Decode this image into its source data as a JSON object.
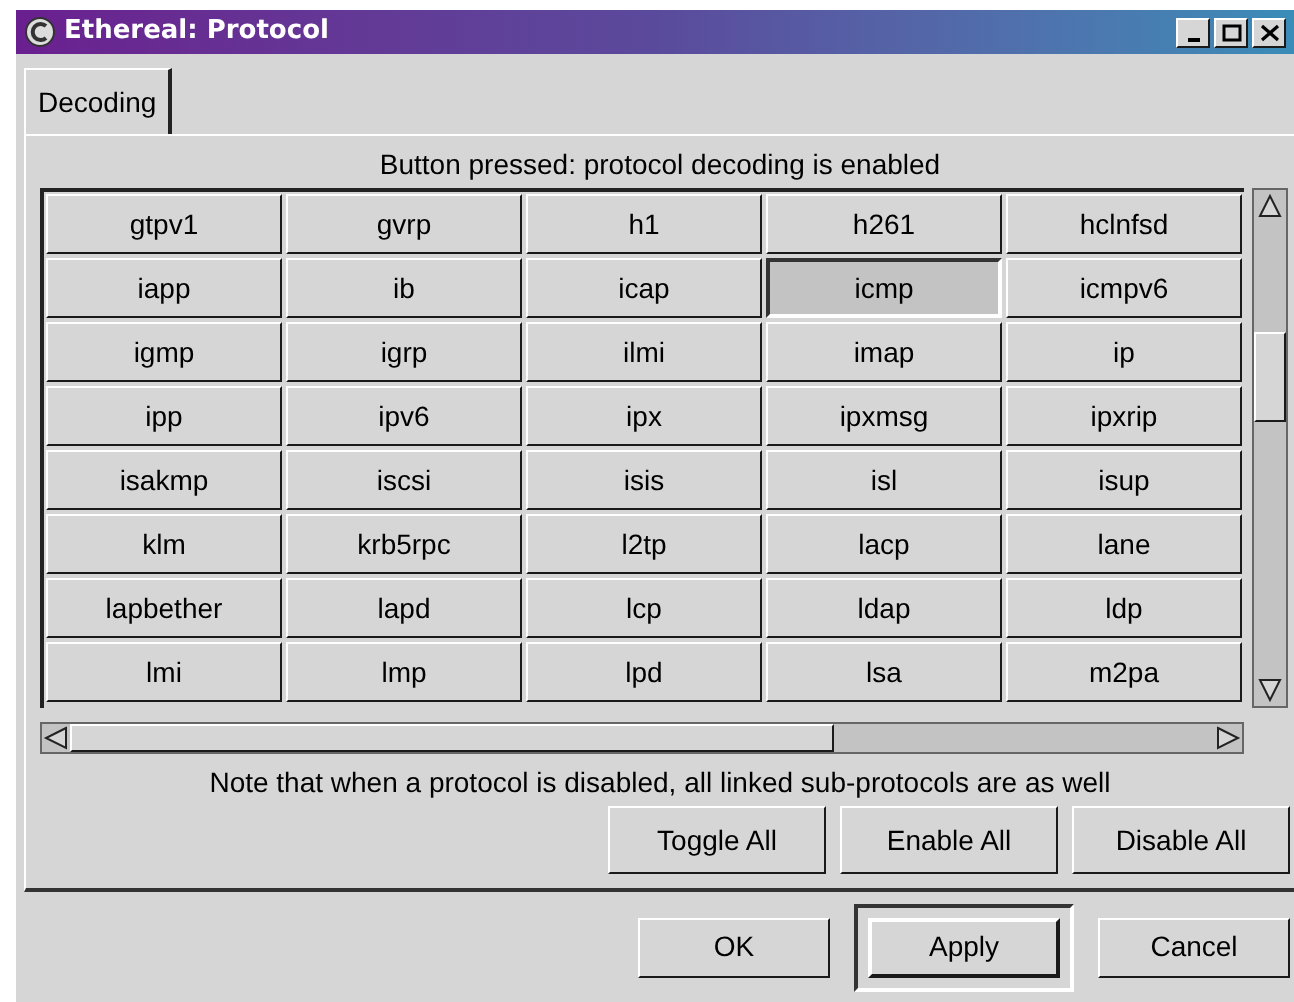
{
  "window": {
    "title": "Ethereal: Protocol"
  },
  "tabs": [
    {
      "label": "Decoding",
      "selected": true
    }
  ],
  "hint": "Button pressed: protocol decoding is enabled",
  "protocols": [
    {
      "label": "gtpv1",
      "pressed": false
    },
    {
      "label": "gvrp",
      "pressed": false
    },
    {
      "label": "h1",
      "pressed": false
    },
    {
      "label": "h261",
      "pressed": false
    },
    {
      "label": "hclnfsd",
      "pressed": false
    },
    {
      "label": "iapp",
      "pressed": false
    },
    {
      "label": "ib",
      "pressed": false
    },
    {
      "label": "icap",
      "pressed": false
    },
    {
      "label": "icmp",
      "pressed": true
    },
    {
      "label": "icmpv6",
      "pressed": false
    },
    {
      "label": "igmp",
      "pressed": false
    },
    {
      "label": "igrp",
      "pressed": false
    },
    {
      "label": "ilmi",
      "pressed": false
    },
    {
      "label": "imap",
      "pressed": false
    },
    {
      "label": "ip",
      "pressed": false
    },
    {
      "label": "ipp",
      "pressed": false
    },
    {
      "label": "ipv6",
      "pressed": false
    },
    {
      "label": "ipx",
      "pressed": false
    },
    {
      "label": "ipxmsg",
      "pressed": false
    },
    {
      "label": "ipxrip",
      "pressed": false
    },
    {
      "label": "isakmp",
      "pressed": false
    },
    {
      "label": "iscsi",
      "pressed": false
    },
    {
      "label": "isis",
      "pressed": false
    },
    {
      "label": "isl",
      "pressed": false
    },
    {
      "label": "isup",
      "pressed": false
    },
    {
      "label": "klm",
      "pressed": false
    },
    {
      "label": "krb5rpc",
      "pressed": false
    },
    {
      "label": "l2tp",
      "pressed": false
    },
    {
      "label": "lacp",
      "pressed": false
    },
    {
      "label": "lane",
      "pressed": false
    },
    {
      "label": "lapbether",
      "pressed": false
    },
    {
      "label": "lapd",
      "pressed": false
    },
    {
      "label": "lcp",
      "pressed": false
    },
    {
      "label": "ldap",
      "pressed": false
    },
    {
      "label": "ldp",
      "pressed": false
    },
    {
      "label": "lmi",
      "pressed": false
    },
    {
      "label": "lmp",
      "pressed": false
    },
    {
      "label": "lpd",
      "pressed": false
    },
    {
      "label": "lsa",
      "pressed": false
    },
    {
      "label": "m2pa",
      "pressed": false
    }
  ],
  "note": "Note that when a protocol is disabled, all linked sub-protocols are as well",
  "panel_buttons": [
    "Toggle All",
    "Enable All",
    "Disable All"
  ],
  "dialog_buttons": [
    {
      "label": "OK",
      "default": false
    },
    {
      "label": "Apply",
      "default": true
    },
    {
      "label": "Cancel",
      "default": false
    }
  ]
}
